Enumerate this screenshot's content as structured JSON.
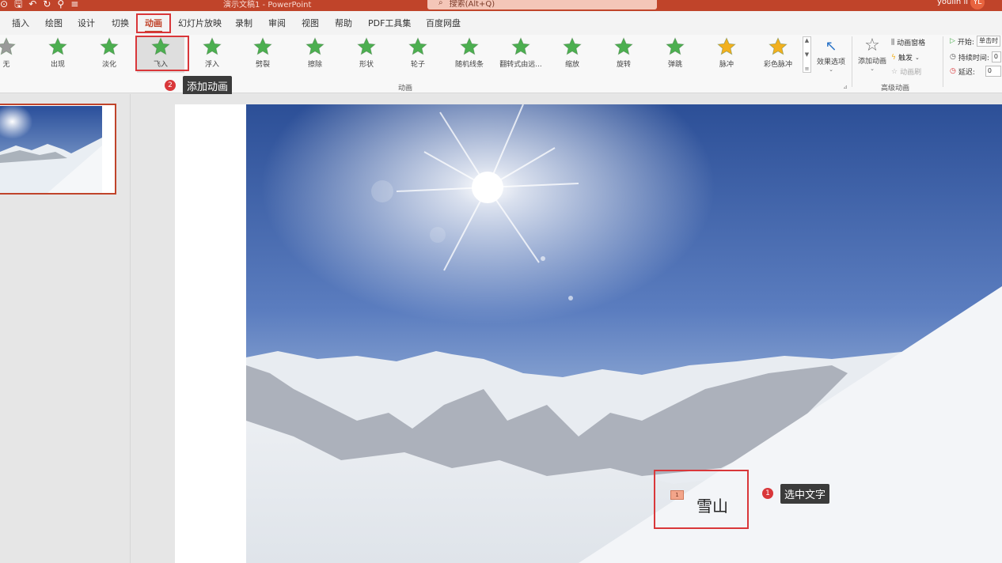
{
  "titlebar": {
    "doc_title": "演示文稿1 - PowerPoint",
    "search_placeholder": "搜索(Alt+Q)",
    "user_name": "youlin li",
    "avatar_initials": "YL"
  },
  "tabs": [
    {
      "label": "插入"
    },
    {
      "label": "绘图"
    },
    {
      "label": "设计"
    },
    {
      "label": "切换"
    },
    {
      "label": "动画"
    },
    {
      "label": "幻灯片放映"
    },
    {
      "label": "录制"
    },
    {
      "label": "审阅"
    },
    {
      "label": "视图"
    },
    {
      "label": "帮助"
    },
    {
      "label": "PDF工具集"
    },
    {
      "label": "百度网盘"
    }
  ],
  "active_tab": "动画",
  "ribbon": {
    "animations": [
      {
        "label": "无",
        "color": "#9a9a9a"
      },
      {
        "label": "出现",
        "color": "#4caf50"
      },
      {
        "label": "淡化",
        "color": "#4caf50"
      },
      {
        "label": "飞入",
        "color": "#4caf50"
      },
      {
        "label": "浮入",
        "color": "#4caf50"
      },
      {
        "label": "劈裂",
        "color": "#4caf50"
      },
      {
        "label": "擦除",
        "color": "#4caf50"
      },
      {
        "label": "形状",
        "color": "#4caf50"
      },
      {
        "label": "轮子",
        "color": "#4caf50"
      },
      {
        "label": "随机线条",
        "color": "#4caf50"
      },
      {
        "label": "翻转式由远...",
        "color": "#4caf50"
      },
      {
        "label": "缩放",
        "color": "#4caf50"
      },
      {
        "label": "旋转",
        "color": "#4caf50"
      },
      {
        "label": "弹跳",
        "color": "#4caf50"
      },
      {
        "label": "脉冲",
        "color": "#f2b01e"
      },
      {
        "label": "彩色脉冲",
        "color": "#f2b01e"
      }
    ],
    "effect_options_label": "效果选项",
    "group_animation_label": "动画",
    "advanced": {
      "add_animation_label": "添加动画",
      "pane_label": "动画窗格",
      "trigger_label": "触发",
      "painter_label": "动画刷",
      "group_label": "高级动画"
    },
    "timing": {
      "start_label": "开始:",
      "start_value": "单击时",
      "duration_label": "持续时间:",
      "duration_value": "0",
      "delay_label": "延迟:",
      "delay_value": "0"
    }
  },
  "annotations": {
    "step1_number": "1",
    "step1_text": "选中文字",
    "step2_number": "2",
    "step2_text": "添加动画"
  },
  "slide": {
    "title_text": "雪山",
    "animation_order": "1"
  }
}
